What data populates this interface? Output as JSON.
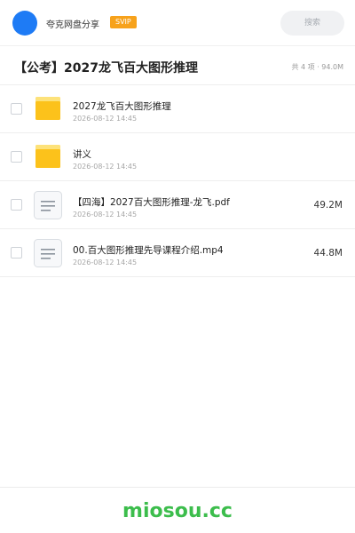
{
  "header": {
    "app_name": "夸克网盘分享",
    "badge": "SVIP",
    "search_placeholder": "搜索",
    "avatar_color": "#1e7bf5",
    "badge_color": "#f7a21b"
  },
  "share": {
    "title": "【公考】2027龙飞百大图形推理",
    "meta": "共 4 项 · 94.0M"
  },
  "files": [
    {
      "type": "folder",
      "icon": "folder-icon",
      "name": "2027龙飞百大图形推理",
      "time": "2026-08-12 14:45",
      "size": ""
    },
    {
      "type": "folder",
      "icon": "folder-icon",
      "name": "讲义",
      "time": "2026-08-12 14:45",
      "size": ""
    },
    {
      "type": "file",
      "icon": "document-icon",
      "name": "【四海】2027百大图形推理-龙飞.pdf",
      "time": "2026-08-12 14:45",
      "size": "49.2M"
    },
    {
      "type": "file",
      "icon": "document-icon",
      "name": "00.百大图形推理先导课程介绍.mp4",
      "time": "2026-08-12 14:45",
      "size": "44.8M"
    }
  ],
  "footer": {
    "watermark": "miosou.cc",
    "watermark_color": "#3cbd4c"
  },
  "colors": {
    "folder": "#fcc21b",
    "folder_tab": "#fde27a",
    "doc_border": "#d9dde2",
    "doc_lines": "#8b939c"
  }
}
